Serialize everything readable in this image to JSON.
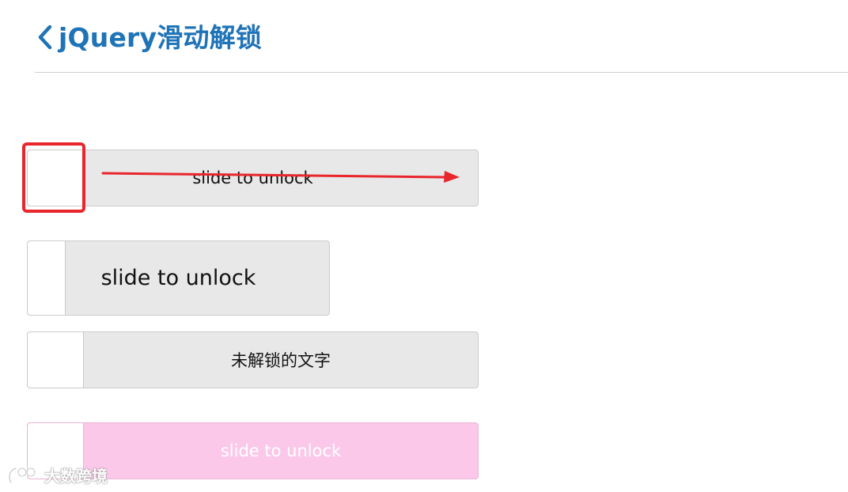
{
  "header": {
    "title": "jQuery滑动解锁",
    "accent_color": "#1f73b7",
    "back_icon": "chevron-left-icon"
  },
  "sliders": [
    {
      "label": "slide to unlock",
      "track_color": "#e8e8e8"
    },
    {
      "label": "slide to unlock",
      "track_color": "#e8e8e8"
    },
    {
      "label": "未解锁的文字",
      "track_color": "#e8e8e8"
    },
    {
      "label": "slide to unlock",
      "track_color": "#fbc8ea",
      "text_color": "#ffffff"
    }
  ],
  "annotation": {
    "highlight_color": "#e8262c",
    "arrow_icon": "arrow-right-icon"
  },
  "watermark": {
    "text": "大数跨境",
    "logo_icon": "brand-logo-icon"
  }
}
